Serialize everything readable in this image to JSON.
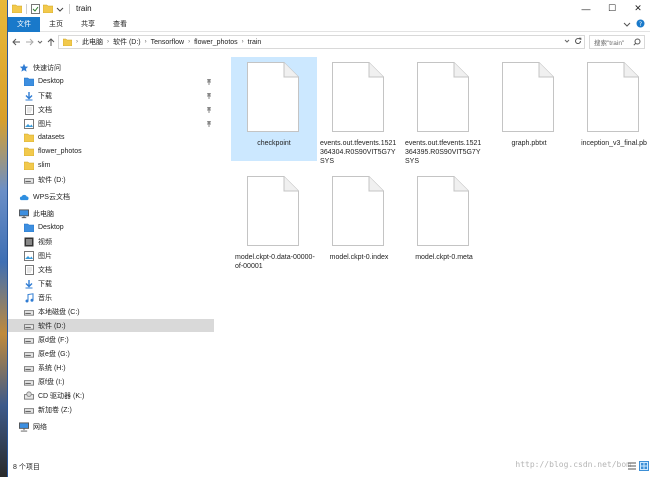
{
  "window": {
    "title": "train",
    "controls": {
      "minimize": "—",
      "maximize": "☐",
      "close": "✕"
    }
  },
  "ribbon": {
    "tabs": [
      {
        "label": "文件",
        "active": true
      },
      {
        "label": "主页",
        "active": false
      },
      {
        "label": "共享",
        "active": false
      },
      {
        "label": "查看",
        "active": false
      }
    ]
  },
  "address": {
    "crumbs": [
      "此电脑",
      "软件 (D:)",
      "Tensorflow",
      "flower_photos",
      "train"
    ],
    "search_placeholder": "搜索\"train\""
  },
  "nav": {
    "items": [
      {
        "label": "快速访问",
        "icon": "star-icon",
        "level": 0,
        "pinned": false,
        "selected": false
      },
      {
        "label": "Desktop",
        "icon": "folder-blue-icon",
        "level": 1,
        "pinned": true,
        "selected": false
      },
      {
        "label": "下载",
        "icon": "download-icon",
        "level": 1,
        "pinned": true,
        "selected": false
      },
      {
        "label": "文档",
        "icon": "document-icon",
        "level": 1,
        "pinned": true,
        "selected": false
      },
      {
        "label": "图片",
        "icon": "picture-icon",
        "level": 1,
        "pinned": true,
        "selected": false
      },
      {
        "label": "datasets",
        "icon": "folder-icon",
        "level": 1,
        "pinned": false,
        "selected": false
      },
      {
        "label": "flower_photos",
        "icon": "folder-icon",
        "level": 1,
        "pinned": false,
        "selected": false
      },
      {
        "label": "slim",
        "icon": "folder-icon",
        "level": 1,
        "pinned": false,
        "selected": false
      },
      {
        "label": "软件 (D:)",
        "icon": "drive-icon",
        "level": 1,
        "pinned": false,
        "selected": false
      },
      {
        "label": "WPS云文档",
        "icon": "cloud-icon",
        "level": 0,
        "pinned": false,
        "selected": false
      },
      {
        "label": "此电脑",
        "icon": "computer-icon",
        "level": 0,
        "pinned": false,
        "selected": false
      },
      {
        "label": "Desktop",
        "icon": "folder-blue-icon",
        "level": 1,
        "pinned": false,
        "selected": false
      },
      {
        "label": "视频",
        "icon": "video-icon",
        "level": 1,
        "pinned": false,
        "selected": false
      },
      {
        "label": "图片",
        "icon": "picture-icon",
        "level": 1,
        "pinned": false,
        "selected": false
      },
      {
        "label": "文档",
        "icon": "document-icon",
        "level": 1,
        "pinned": false,
        "selected": false
      },
      {
        "label": "下载",
        "icon": "download-icon",
        "level": 1,
        "pinned": false,
        "selected": false
      },
      {
        "label": "音乐",
        "icon": "music-icon",
        "level": 1,
        "pinned": false,
        "selected": false
      },
      {
        "label": "本地磁盘 (C:)",
        "icon": "drive-icon",
        "level": 1,
        "pinned": false,
        "selected": false
      },
      {
        "label": "软件 (D:)",
        "icon": "drive-icon",
        "level": 1,
        "pinned": false,
        "selected": true
      },
      {
        "label": "原d盘 (F:)",
        "icon": "drive-icon",
        "level": 1,
        "pinned": false,
        "selected": false
      },
      {
        "label": "原e盘 (G:)",
        "icon": "drive-icon",
        "level": 1,
        "pinned": false,
        "selected": false
      },
      {
        "label": "系统 (H:)",
        "icon": "drive-icon",
        "level": 1,
        "pinned": false,
        "selected": false
      },
      {
        "label": "原f盘 (I:)",
        "icon": "drive-icon",
        "level": 1,
        "pinned": false,
        "selected": false
      },
      {
        "label": "CD 驱动器 (K:)",
        "icon": "cd-drive-icon",
        "level": 1,
        "pinned": false,
        "selected": false
      },
      {
        "label": "新加卷 (Z:)",
        "icon": "drive-icon",
        "level": 1,
        "pinned": false,
        "selected": false
      },
      {
        "label": "网络",
        "icon": "network-icon",
        "level": 0,
        "pinned": false,
        "selected": false
      }
    ]
  },
  "files": [
    {
      "name": "checkpoint",
      "selected": true
    },
    {
      "name": "events.out.tfevents.1521364304.R0S90VIT5G7YSYS",
      "selected": false
    },
    {
      "name": "events.out.tfevents.1521364395.R0S90VIT5G7YSYS",
      "selected": false
    },
    {
      "name": "graph.pbtxt",
      "selected": false
    },
    {
      "name": "inception_v3_final.pb",
      "selected": false
    },
    {
      "name": "model.ckpt-0.data-00000-of-00001",
      "selected": false
    },
    {
      "name": "model.ckpt-0.index",
      "selected": false
    },
    {
      "name": "model.ckpt-0.meta",
      "selected": false
    }
  ],
  "status": {
    "count": "8 个项目",
    "watermark": "http://blog.csdn.net/bom"
  },
  "colors": {
    "accent": "#1979ca",
    "selected_item": "#cce8ff",
    "nav_selected": "#d9d9d9"
  }
}
